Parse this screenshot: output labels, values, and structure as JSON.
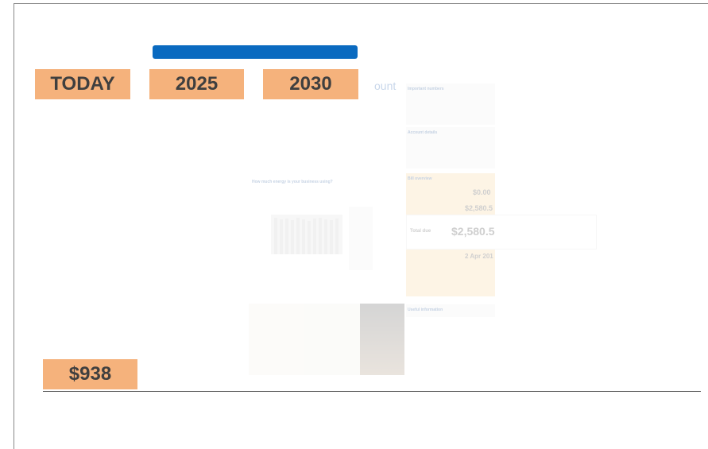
{
  "timeline": {
    "progress_percent": 100,
    "bar_color": "#0a6ac0",
    "labels": {
      "today": "TODAY",
      "year1": "2025",
      "year2": "2030"
    },
    "label_color": "#f5b27c"
  },
  "price": {
    "value": "$938"
  },
  "bill": {
    "heading_fragment": "ount",
    "important_numbers": "Important numbers",
    "account_details": "Account details",
    "energy_question": "How much energy is your business using?",
    "bill_overview": "Bill overview",
    "amount_1": "$0.00",
    "amount_2": "$2,580.5",
    "total_due_label": "Total due",
    "total_due": "$2,580.5",
    "due_date": "2 Apr 201",
    "useful_information": "Useful information"
  }
}
